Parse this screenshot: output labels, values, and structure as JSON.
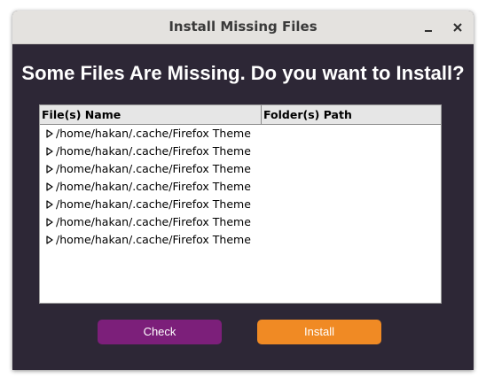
{
  "window": {
    "title": "Install Missing Files"
  },
  "headline": "Some Files Are Missing. Do you want to Install?",
  "table": {
    "columns": [
      "File(s) Name",
      "Folder(s) Path"
    ],
    "rows": [
      {
        "name": "/home/hakan/.cache/Firefox Theme",
        "path": ""
      },
      {
        "name": "/home/hakan/.cache/Firefox Theme",
        "path": ""
      },
      {
        "name": "/home/hakan/.cache/Firefox Theme",
        "path": ""
      },
      {
        "name": "/home/hakan/.cache/Firefox Theme",
        "path": ""
      },
      {
        "name": "/home/hakan/.cache/Firefox Theme",
        "path": ""
      },
      {
        "name": "/home/hakan/.cache/Firefox Theme",
        "path": ""
      },
      {
        "name": "/home/hakan/.cache/Firefox Theme",
        "path": ""
      }
    ]
  },
  "buttons": {
    "check_label": "Check",
    "install_label": "Install"
  },
  "colors": {
    "background": "#2d2736",
    "check_button": "#7c1f7a",
    "install_button": "#f08a24"
  },
  "icons": {
    "minimize": "minimize-icon",
    "close": "close-icon",
    "row_expander": "chevron-right-icon"
  }
}
